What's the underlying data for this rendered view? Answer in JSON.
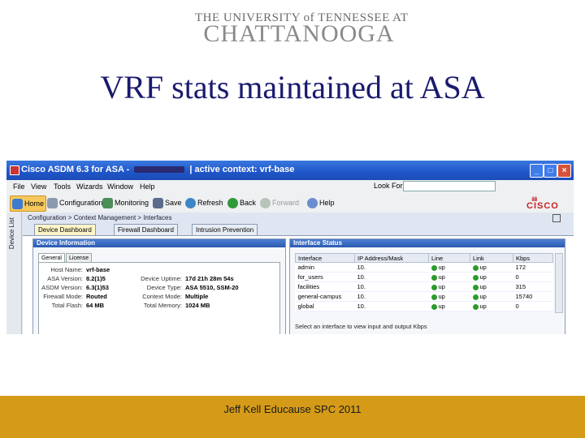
{
  "logo": {
    "line1": "THE UNIVERSITY of TENNESSEE AT",
    "line2": "CHATTANOOGA"
  },
  "slide_title": "VRF stats maintained at ASA",
  "window": {
    "title_prefix": "Cisco ASDM 6.3 for ASA -",
    "title_suffix": "| active context: vrf-base",
    "controls": {
      "minimize": "_",
      "maximize": "□",
      "close": "×"
    },
    "menu": [
      "File",
      "View",
      "Tools",
      "Wizards",
      "Window",
      "Help"
    ],
    "look_for_label": "Look For:",
    "look_for_value": "",
    "toolbar": {
      "home": "Home",
      "configuration": "Configuration",
      "monitoring": "Monitoring",
      "save": "Save",
      "refresh": "Refresh",
      "back": "Back",
      "forward": "Forward",
      "help": "Help"
    },
    "brand": "CISCO",
    "side_label": "Device List",
    "breadcrumb": "Configuration > Context Management > Interfaces",
    "tabs": [
      "Device Dashboard",
      "Firewall Dashboard",
      "Intrusion Prevention"
    ],
    "device_info": {
      "title": "Device Information",
      "subtabs": [
        "General",
        "License"
      ],
      "left": [
        {
          "k": "Host Name:",
          "v": "vrf-base"
        },
        {
          "k": "ASA Version:",
          "v": "8.2(1)5"
        },
        {
          "k": "ASDM Version:",
          "v": "6.3(1)53"
        },
        {
          "k": "Firewall Mode:",
          "v": "Routed"
        },
        {
          "k": "Total Flash:",
          "v": "64 MB"
        }
      ],
      "right": [
        {
          "k": "Device Uptime:",
          "v": "17d 21h 28m 54s"
        },
        {
          "k": "Device Type:",
          "v": "ASA 5510, SSM-20"
        },
        {
          "k": "Context Mode:",
          "v": "Multiple"
        },
        {
          "k": "Total Memory:",
          "v": "1024 MB"
        }
      ]
    },
    "interface_status": {
      "title": "Interface Status",
      "columns": [
        "Interface",
        "IP Address/Mask",
        "Line",
        "Link",
        "Kbps"
      ],
      "rows": [
        {
          "iface": "admin",
          "ip": "10.",
          "line": "up",
          "link": "up",
          "kbps": "172"
        },
        {
          "iface": "for_users",
          "ip": "10.",
          "line": "up",
          "link": "up",
          "kbps": "0"
        },
        {
          "iface": "facilities",
          "ip": "10.",
          "line": "up",
          "link": "up",
          "kbps": "315"
        },
        {
          "iface": "general-campus",
          "ip": "10.",
          "line": "up",
          "link": "up",
          "kbps": "15740"
        },
        {
          "iface": "global",
          "ip": "10.",
          "line": "up",
          "link": "up",
          "kbps": "0"
        }
      ],
      "hint": "Select an interface to view input and output Kbps"
    }
  },
  "footer": "Jeff Kell   Educause SPC 2011",
  "colors": {
    "title": "#1a1a6e",
    "footer_bg": "#d59b18",
    "titlebar": "#1f55c8"
  }
}
